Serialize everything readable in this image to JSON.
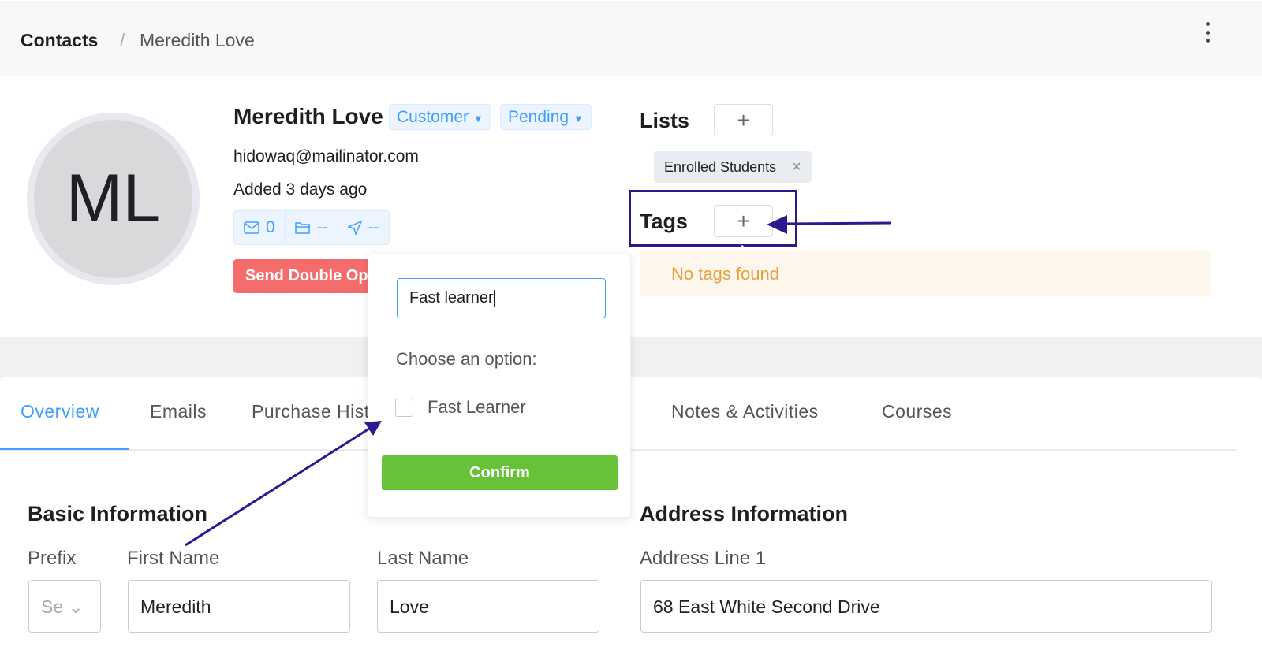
{
  "breadcrumb": {
    "root": "Contacts",
    "separator": "/",
    "current": "Meredith Love"
  },
  "contact": {
    "initials": "ML",
    "name": "Meredith Love",
    "type": "Customer",
    "status": "Pending",
    "email": "hidowaq@mailinator.com",
    "added": "Added 3 days ago",
    "stats": {
      "emails": "0",
      "folder": "--",
      "sent": "--"
    },
    "send_button": "Send Double Opt-in Email"
  },
  "lists": {
    "title": "Lists",
    "add": "+",
    "items": [
      {
        "label": "Enrolled Students",
        "remove": "×"
      }
    ]
  },
  "tags": {
    "title": "Tags",
    "add": "+",
    "empty": "No tags found"
  },
  "popover": {
    "input_value": "Fast learner",
    "choose": "Choose an option:",
    "options": [
      {
        "label": "Fast Learner",
        "checked": false
      }
    ],
    "confirm": "Confirm"
  },
  "tabs": [
    {
      "label": "Overview",
      "active": true
    },
    {
      "label": "Emails"
    },
    {
      "label": "Purchase History"
    },
    {
      "label": "Notes & Activities"
    },
    {
      "label": "Courses"
    }
  ],
  "basic": {
    "title": "Basic Information",
    "prefix_label": "Prefix",
    "prefix_placeholder": "Select",
    "first_label": "First Name",
    "first_value": "Meredith",
    "last_label": "Last Name",
    "last_value": "Love"
  },
  "address": {
    "title": "Address Information",
    "line1_label": "Address Line 1",
    "line1_value": "68 East White Second Drive"
  },
  "colors": {
    "primary": "#409eff",
    "danger": "#f56c6c",
    "success": "#67c23a",
    "warning": "#e6a23c",
    "annotation": "#2b1a8f"
  }
}
